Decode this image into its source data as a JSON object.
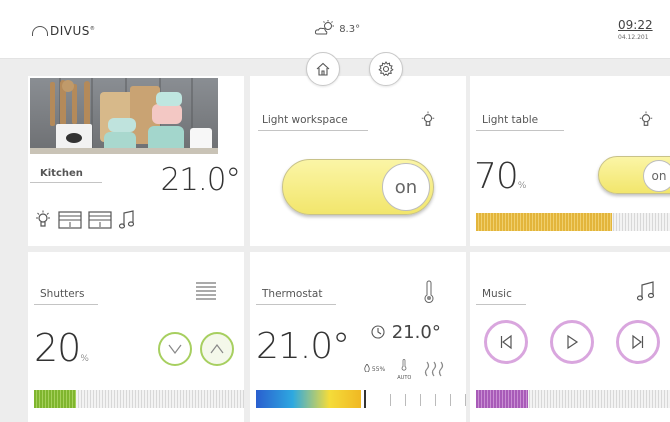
{
  "header": {
    "logo": "DIVUS",
    "weather_temp": "8.3°",
    "time": "09:22",
    "date": "04.12.201"
  },
  "nav": {
    "home_icon": "home-icon",
    "settings_icon": "gear-icon"
  },
  "kitchen": {
    "label": "Kitchen",
    "temperature": "21.0°",
    "icons": [
      "bulb-icon",
      "shutter-icon",
      "shutter-icon",
      "music-note-icon"
    ]
  },
  "light_workspace": {
    "label": "Light workspace",
    "state": "on",
    "icon": "bulb-icon"
  },
  "light_table": {
    "label": "Light table",
    "value": "70",
    "unit": "%",
    "state": "on",
    "level": 0.7,
    "accent": "#e3b53b"
  },
  "shutters": {
    "label": "Shutters",
    "value": "20",
    "unit": "%",
    "level": 0.2,
    "accent": "#8cbf3a"
  },
  "thermostat": {
    "label": "Thermostat",
    "value": "21.0°",
    "setpoint": "21.0°",
    "humidity": "55%",
    "mode": "AUTO",
    "level": 0.5
  },
  "music": {
    "label": "Music",
    "level": 0.27,
    "accent": "#b673c2"
  }
}
